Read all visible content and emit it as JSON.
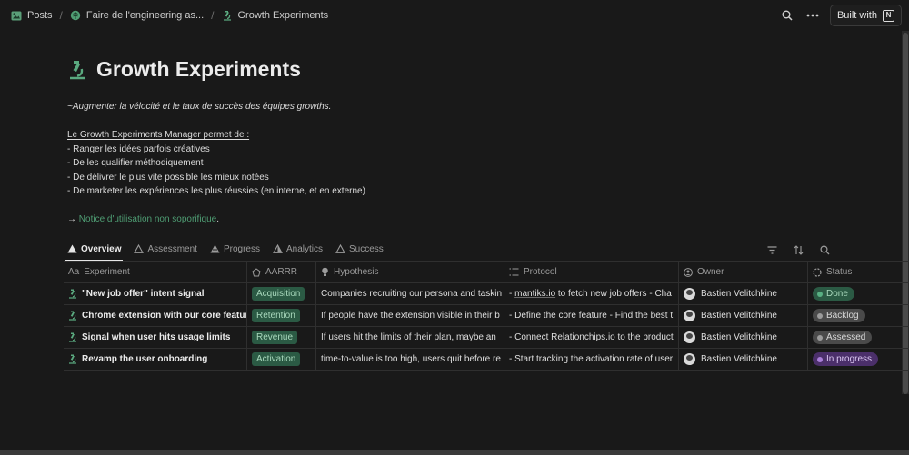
{
  "breadcrumb": [
    {
      "label": "Posts",
      "icon": "photo-icon"
    },
    {
      "label": "Faire de l'engineering as...",
      "icon": "brain-icon"
    },
    {
      "label": "Growth Experiments",
      "icon": "microscope-icon"
    }
  ],
  "topbar": {
    "built_with_label": "Built with"
  },
  "page": {
    "title": "Growth Experiments",
    "subtitle": "~Augmenter la vélocité et le taux de succès des équipes growths.",
    "intro_heading": "Le Growth Experiments Manager permet de :",
    "bullets": [
      "- Ranger les idées parfois créatives",
      "- De les qualifier méthodiquement",
      "- De délivrer le plus vite possible les mieux notées",
      "- De marketer les expériences les plus réussies (en interne, et en externe)"
    ],
    "notice_arrow": "→",
    "notice_link": "Notice d'utilisation non soporifique",
    "notice_end": "."
  },
  "tabs": [
    {
      "label": "Overview",
      "active": true
    },
    {
      "label": "Assessment",
      "active": false
    },
    {
      "label": "Progress",
      "active": false
    },
    {
      "label": "Analytics",
      "active": false
    },
    {
      "label": "Success",
      "active": false
    }
  ],
  "table": {
    "columns": [
      "Experiment",
      "AARRR",
      "Hypothesis",
      "Protocol",
      "Owner",
      "Status"
    ],
    "column_prefix": "Aa",
    "rows": [
      {
        "experiment": "\"New job offer\" intent signal",
        "aarrr": "Acquisition",
        "hypothesis": "Companies recruiting our persona and taskin",
        "protocol_pre": "- ",
        "protocol_link": "mantiks.io",
        "protocol_post": " to fetch new job offers - Cha",
        "owner": "Bastien Velitchkine",
        "status": "Done",
        "status_bg": "#2b5a44",
        "status_dot": "#58b083",
        "status_fg": "#a8d8bc"
      },
      {
        "experiment": "Chrome extension with our core featur",
        "aarrr": "Retention",
        "hypothesis": "If people have the extension visible in their b",
        "protocol_pre": "- Define the core feature - Find the best t",
        "protocol_link": "",
        "protocol_post": "",
        "owner": "Bastien Velitchkine",
        "status": "Backlog",
        "status_bg": "#4a4a4a",
        "status_dot": "#9b9b9b",
        "status_fg": "#d8d8d8"
      },
      {
        "experiment": "Signal when user hits usage limits",
        "aarrr": "Revenue",
        "hypothesis": "If users hit the limits of their plan, maybe an",
        "protocol_pre": "- Connect ",
        "protocol_link": "Relationchips.io",
        "protocol_post": " to the product",
        "owner": "Bastien Velitchkine",
        "status": "Assessed",
        "status_bg": "#4a4a4a",
        "status_dot": "#9b9b9b",
        "status_fg": "#d8d8d8"
      },
      {
        "experiment": "Revamp the user onboarding",
        "aarrr": "Activation",
        "hypothesis": "time-to-value is too high, users quit before re",
        "protocol_pre": "- Start tracking the activation rate of user",
        "protocol_link": "",
        "protocol_post": "",
        "owner": "Bastien Velitchkine",
        "status": "In progress",
        "status_bg": "#4b2f6a",
        "status_dot": "#a97ed8",
        "status_fg": "#dcc8f3"
      }
    ]
  }
}
